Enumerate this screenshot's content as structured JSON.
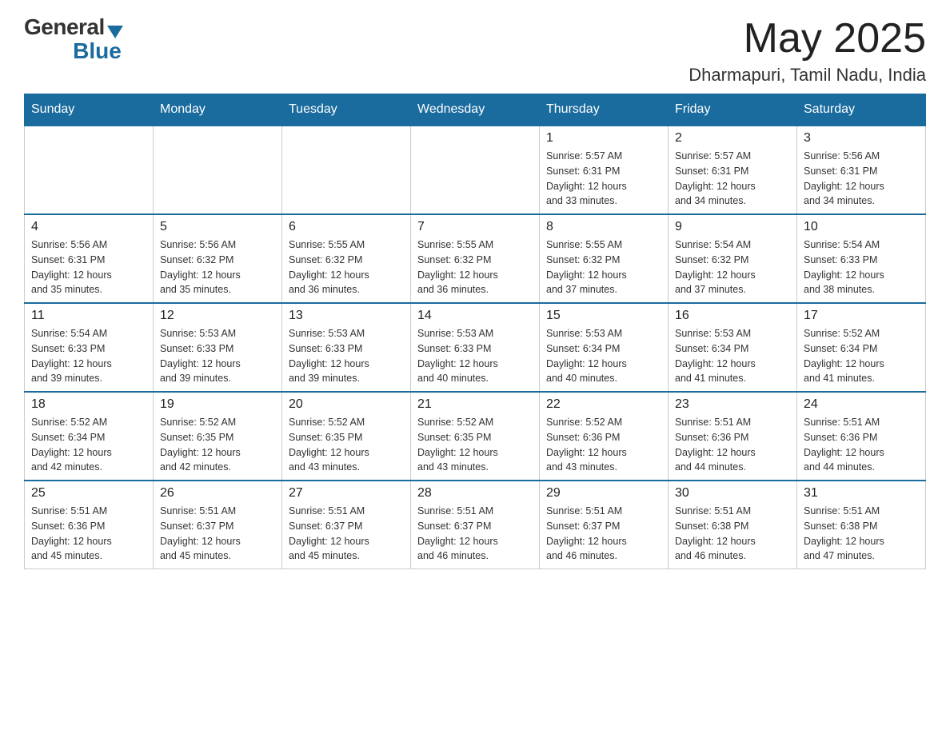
{
  "header": {
    "month_title": "May 2025",
    "location": "Dharmapuri, Tamil Nadu, India",
    "logo_general": "General",
    "logo_blue": "Blue"
  },
  "weekdays": [
    "Sunday",
    "Monday",
    "Tuesday",
    "Wednesday",
    "Thursday",
    "Friday",
    "Saturday"
  ],
  "weeks": [
    [
      {
        "day": "",
        "info": ""
      },
      {
        "day": "",
        "info": ""
      },
      {
        "day": "",
        "info": ""
      },
      {
        "day": "",
        "info": ""
      },
      {
        "day": "1",
        "info": "Sunrise: 5:57 AM\nSunset: 6:31 PM\nDaylight: 12 hours\nand 33 minutes."
      },
      {
        "day": "2",
        "info": "Sunrise: 5:57 AM\nSunset: 6:31 PM\nDaylight: 12 hours\nand 34 minutes."
      },
      {
        "day": "3",
        "info": "Sunrise: 5:56 AM\nSunset: 6:31 PM\nDaylight: 12 hours\nand 34 minutes."
      }
    ],
    [
      {
        "day": "4",
        "info": "Sunrise: 5:56 AM\nSunset: 6:31 PM\nDaylight: 12 hours\nand 35 minutes."
      },
      {
        "day": "5",
        "info": "Sunrise: 5:56 AM\nSunset: 6:32 PM\nDaylight: 12 hours\nand 35 minutes."
      },
      {
        "day": "6",
        "info": "Sunrise: 5:55 AM\nSunset: 6:32 PM\nDaylight: 12 hours\nand 36 minutes."
      },
      {
        "day": "7",
        "info": "Sunrise: 5:55 AM\nSunset: 6:32 PM\nDaylight: 12 hours\nand 36 minutes."
      },
      {
        "day": "8",
        "info": "Sunrise: 5:55 AM\nSunset: 6:32 PM\nDaylight: 12 hours\nand 37 minutes."
      },
      {
        "day": "9",
        "info": "Sunrise: 5:54 AM\nSunset: 6:32 PM\nDaylight: 12 hours\nand 37 minutes."
      },
      {
        "day": "10",
        "info": "Sunrise: 5:54 AM\nSunset: 6:33 PM\nDaylight: 12 hours\nand 38 minutes."
      }
    ],
    [
      {
        "day": "11",
        "info": "Sunrise: 5:54 AM\nSunset: 6:33 PM\nDaylight: 12 hours\nand 39 minutes."
      },
      {
        "day": "12",
        "info": "Sunrise: 5:53 AM\nSunset: 6:33 PM\nDaylight: 12 hours\nand 39 minutes."
      },
      {
        "day": "13",
        "info": "Sunrise: 5:53 AM\nSunset: 6:33 PM\nDaylight: 12 hours\nand 39 minutes."
      },
      {
        "day": "14",
        "info": "Sunrise: 5:53 AM\nSunset: 6:33 PM\nDaylight: 12 hours\nand 40 minutes."
      },
      {
        "day": "15",
        "info": "Sunrise: 5:53 AM\nSunset: 6:34 PM\nDaylight: 12 hours\nand 40 minutes."
      },
      {
        "day": "16",
        "info": "Sunrise: 5:53 AM\nSunset: 6:34 PM\nDaylight: 12 hours\nand 41 minutes."
      },
      {
        "day": "17",
        "info": "Sunrise: 5:52 AM\nSunset: 6:34 PM\nDaylight: 12 hours\nand 41 minutes."
      }
    ],
    [
      {
        "day": "18",
        "info": "Sunrise: 5:52 AM\nSunset: 6:34 PM\nDaylight: 12 hours\nand 42 minutes."
      },
      {
        "day": "19",
        "info": "Sunrise: 5:52 AM\nSunset: 6:35 PM\nDaylight: 12 hours\nand 42 minutes."
      },
      {
        "day": "20",
        "info": "Sunrise: 5:52 AM\nSunset: 6:35 PM\nDaylight: 12 hours\nand 43 minutes."
      },
      {
        "day": "21",
        "info": "Sunrise: 5:52 AM\nSunset: 6:35 PM\nDaylight: 12 hours\nand 43 minutes."
      },
      {
        "day": "22",
        "info": "Sunrise: 5:52 AM\nSunset: 6:36 PM\nDaylight: 12 hours\nand 43 minutes."
      },
      {
        "day": "23",
        "info": "Sunrise: 5:51 AM\nSunset: 6:36 PM\nDaylight: 12 hours\nand 44 minutes."
      },
      {
        "day": "24",
        "info": "Sunrise: 5:51 AM\nSunset: 6:36 PM\nDaylight: 12 hours\nand 44 minutes."
      }
    ],
    [
      {
        "day": "25",
        "info": "Sunrise: 5:51 AM\nSunset: 6:36 PM\nDaylight: 12 hours\nand 45 minutes."
      },
      {
        "day": "26",
        "info": "Sunrise: 5:51 AM\nSunset: 6:37 PM\nDaylight: 12 hours\nand 45 minutes."
      },
      {
        "day": "27",
        "info": "Sunrise: 5:51 AM\nSunset: 6:37 PM\nDaylight: 12 hours\nand 45 minutes."
      },
      {
        "day": "28",
        "info": "Sunrise: 5:51 AM\nSunset: 6:37 PM\nDaylight: 12 hours\nand 46 minutes."
      },
      {
        "day": "29",
        "info": "Sunrise: 5:51 AM\nSunset: 6:37 PM\nDaylight: 12 hours\nand 46 minutes."
      },
      {
        "day": "30",
        "info": "Sunrise: 5:51 AM\nSunset: 6:38 PM\nDaylight: 12 hours\nand 46 minutes."
      },
      {
        "day": "31",
        "info": "Sunrise: 5:51 AM\nSunset: 6:38 PM\nDaylight: 12 hours\nand 47 minutes."
      }
    ]
  ]
}
